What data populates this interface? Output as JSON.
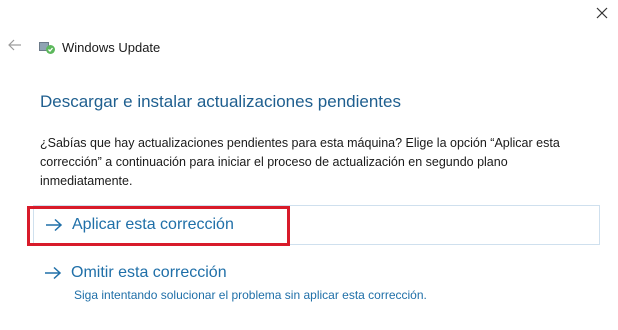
{
  "window": {
    "close_icon": "close-icon"
  },
  "header": {
    "back_icon": "back-arrow-icon",
    "app_icon": "windows-update-icon",
    "app_title": "Windows Update"
  },
  "main": {
    "title": "Descargar e instalar actualizaciones pendientes",
    "description": "¿Sabías que hay actualizaciones pendientes para esta máquina? Elige la opción “Aplicar esta corrección” a continuación para iniciar el proceso de actualización en segundo plano inmediatamente.",
    "options": [
      {
        "label": "Aplicar esta corrección",
        "icon": "arrow-right-icon",
        "highlighted": true
      },
      {
        "label": "Omitir esta corrección",
        "sublabel": "Siga intentando solucionar el problema sin aplicar esta corrección.",
        "icon": "arrow-right-icon"
      }
    ]
  },
  "colors": {
    "title_blue": "#1f5f8f",
    "link_blue": "#1f6fa8",
    "highlight_red": "#d81b2a",
    "option_border": "#cfe0ee",
    "app_icon_green": "#5cb85c"
  }
}
